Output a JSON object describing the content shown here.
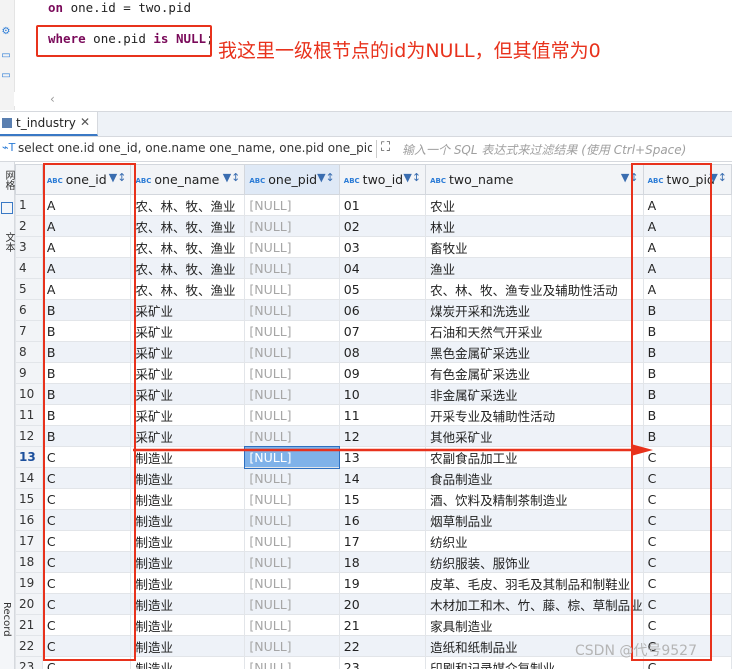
{
  "editor": {
    "line1_kw": "on",
    "line1_rest": " one.id = two.pid",
    "line2_kw1": "where",
    "line2_mid": " one.pid ",
    "line2_kw2": "is",
    "line2_kw3": "NULL",
    "line2_end": ";",
    "annotation": "我这里一级根节点的id为NULL，但其值常为0"
  },
  "tab": {
    "label": "t_industry",
    "close": "✕"
  },
  "filter": {
    "sql_text": "select one.id one_id, one.name one_name, one.pid one_pid, t",
    "placeholder": "输入一个 SQL 表达式来过滤结果 (使用 Ctrl+Space)"
  },
  "side": {
    "label_grid": "网格",
    "label_text": "文本",
    "label_record": "Record"
  },
  "columns": [
    "one_id",
    "one_name",
    "one_pid",
    "two_id",
    "two_name",
    "two_pid"
  ],
  "column_type": "ABC",
  "rows": [
    {
      "n": "1",
      "one_id": "A",
      "one_name": "农、林、牧、渔业",
      "one_pid": "[NULL]",
      "two_id": "01",
      "two_name": "农业",
      "two_pid": "A"
    },
    {
      "n": "2",
      "one_id": "A",
      "one_name": "农、林、牧、渔业",
      "one_pid": "[NULL]",
      "two_id": "02",
      "two_name": "林业",
      "two_pid": "A"
    },
    {
      "n": "3",
      "one_id": "A",
      "one_name": "农、林、牧、渔业",
      "one_pid": "[NULL]",
      "two_id": "03",
      "two_name": "畜牧业",
      "two_pid": "A"
    },
    {
      "n": "4",
      "one_id": "A",
      "one_name": "农、林、牧、渔业",
      "one_pid": "[NULL]",
      "two_id": "04",
      "two_name": "渔业",
      "two_pid": "A"
    },
    {
      "n": "5",
      "one_id": "A",
      "one_name": "农、林、牧、渔业",
      "one_pid": "[NULL]",
      "two_id": "05",
      "two_name": "农、林、牧、渔专业及辅助性活动",
      "two_pid": "A"
    },
    {
      "n": "6",
      "one_id": "B",
      "one_name": "采矿业",
      "one_pid": "[NULL]",
      "two_id": "06",
      "two_name": "煤炭开采和洗选业",
      "two_pid": "B"
    },
    {
      "n": "7",
      "one_id": "B",
      "one_name": "采矿业",
      "one_pid": "[NULL]",
      "two_id": "07",
      "two_name": "石油和天然气开采业",
      "two_pid": "B"
    },
    {
      "n": "8",
      "one_id": "B",
      "one_name": "采矿业",
      "one_pid": "[NULL]",
      "two_id": "08",
      "two_name": "黑色金属矿采选业",
      "two_pid": "B"
    },
    {
      "n": "9",
      "one_id": "B",
      "one_name": "采矿业",
      "one_pid": "[NULL]",
      "two_id": "09",
      "two_name": "有色金属矿采选业",
      "two_pid": "B"
    },
    {
      "n": "10",
      "one_id": "B",
      "one_name": "采矿业",
      "one_pid": "[NULL]",
      "two_id": "10",
      "two_name": "非金属矿采选业",
      "two_pid": "B"
    },
    {
      "n": "11",
      "one_id": "B",
      "one_name": "采矿业",
      "one_pid": "[NULL]",
      "two_id": "11",
      "two_name": "开采专业及辅助性活动",
      "two_pid": "B"
    },
    {
      "n": "12",
      "one_id": "B",
      "one_name": "采矿业",
      "one_pid": "[NULL]",
      "two_id": "12",
      "two_name": "其他采矿业",
      "two_pid": "B"
    },
    {
      "n": "13",
      "one_id": "C",
      "one_name": "制造业",
      "one_pid": "[NULL]",
      "two_id": "13",
      "two_name": "农副食品加工业",
      "two_pid": "C"
    },
    {
      "n": "14",
      "one_id": "C",
      "one_name": "制造业",
      "one_pid": "[NULL]",
      "two_id": "14",
      "two_name": "食品制造业",
      "two_pid": "C"
    },
    {
      "n": "15",
      "one_id": "C",
      "one_name": "制造业",
      "one_pid": "[NULL]",
      "two_id": "15",
      "two_name": "酒、饮料及精制茶制造业",
      "two_pid": "C"
    },
    {
      "n": "16",
      "one_id": "C",
      "one_name": "制造业",
      "one_pid": "[NULL]",
      "two_id": "16",
      "two_name": "烟草制品业",
      "two_pid": "C"
    },
    {
      "n": "17",
      "one_id": "C",
      "one_name": "制造业",
      "one_pid": "[NULL]",
      "two_id": "17",
      "two_name": "纺织业",
      "two_pid": "C"
    },
    {
      "n": "18",
      "one_id": "C",
      "one_name": "制造业",
      "one_pid": "[NULL]",
      "two_id": "18",
      "two_name": "纺织服装、服饰业",
      "two_pid": "C"
    },
    {
      "n": "19",
      "one_id": "C",
      "one_name": "制造业",
      "one_pid": "[NULL]",
      "two_id": "19",
      "two_name": "皮革、毛皮、羽毛及其制品和制鞋业",
      "two_pid": "C"
    },
    {
      "n": "20",
      "one_id": "C",
      "one_name": "制造业",
      "one_pid": "[NULL]",
      "two_id": "20",
      "two_name": "木材加工和木、竹、藤、棕、草制品业",
      "two_pid": "C"
    },
    {
      "n": "21",
      "one_id": "C",
      "one_name": "制造业",
      "one_pid": "[NULL]",
      "two_id": "21",
      "two_name": "家具制造业",
      "two_pid": "C"
    },
    {
      "n": "22",
      "one_id": "C",
      "one_name": "制造业",
      "one_pid": "[NULL]",
      "two_id": "22",
      "two_name": "造纸和纸制品业",
      "two_pid": "C"
    },
    {
      "n": "23",
      "one_id": "C",
      "one_name": "制造业",
      "one_pid": "[NULL]",
      "two_id": "23",
      "two_name": "印刷和记录媒介复制业",
      "two_pid": "C"
    }
  ],
  "selected_row": "13",
  "watermark": "CSDN @代号9527",
  "colors": {
    "annotation_red": "#e8321c",
    "selection_blue": "#7fb2e9"
  }
}
